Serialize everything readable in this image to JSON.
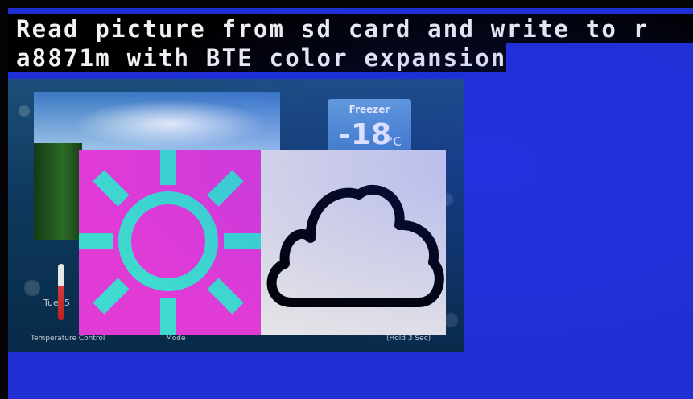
{
  "overlay_text": {
    "line1": "Read picture from sd card and write to r",
    "line2": "a8871m with BTE color expansion"
  },
  "fridge_ui": {
    "freezer_title": "Freezer",
    "freezer_temp": "-18",
    "freezer_unit": "°C",
    "day_label": "Tue: 5",
    "temp_control_label": "Temperature Control",
    "mode_label": "Mode",
    "hold_label": "(Hold 3 Sec)"
  },
  "tiles": {
    "sun_icon": "sun-icon",
    "cloud_icon": "cloud-icon"
  },
  "colors": {
    "screen_blue": "#1f2fd4",
    "sun_bg": "#e13bd6",
    "sun_fg": "#3ed9cf",
    "cloud_bg": "#e6e4e6",
    "cloud_stroke": "#000000"
  }
}
